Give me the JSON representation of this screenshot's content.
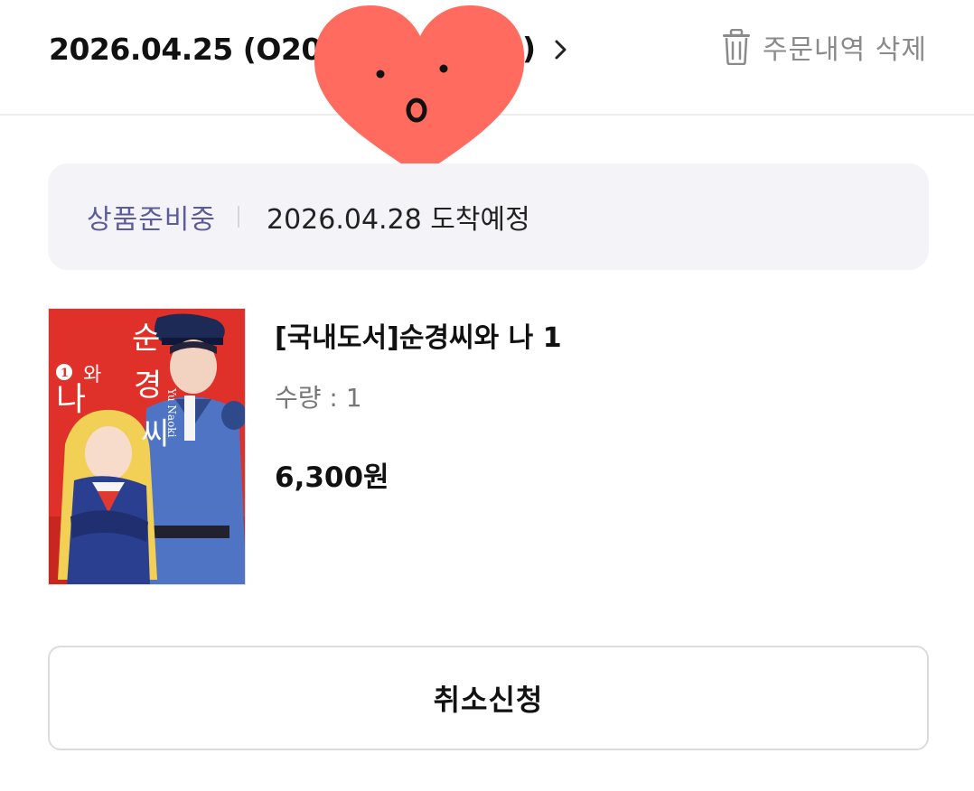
{
  "header": {
    "order_date": "2026.04.25 (O20",
    "order_date_suffix": ")",
    "delete_label": "주문내역 삭제"
  },
  "status": {
    "label": "상품준비중",
    "eta": "2026.04.28 도착예정",
    "label_color": "#5b5c9c"
  },
  "product": {
    "title": "[국내도서]순경씨와 나 1",
    "quantity": "수량 : 1",
    "price": "6,300원",
    "cover": {
      "title_chars": [
        "순",
        "경",
        "씨",
        "와",
        "나"
      ],
      "volume": "1",
      "author": "Yu Naoki",
      "background_color": "#e0302a"
    }
  },
  "actions": {
    "cancel_label": "취소신청"
  },
  "icons": {
    "chevron": "chevron-right-icon",
    "trash": "trash-icon",
    "sticker": "heart-face-sticker"
  },
  "colors": {
    "sticker": "#ff6b5e",
    "status_bg": "#f4f3f8"
  }
}
